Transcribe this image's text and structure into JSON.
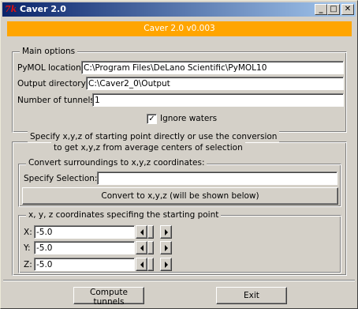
{
  "window": {
    "title": "Caver 2.0",
    "icon_text": "7k",
    "controls": {
      "minimize": "_",
      "maximize": "□",
      "close": "✕"
    }
  },
  "banner": {
    "text": "Caver 2.0 v0.003",
    "color": "#ffa500"
  },
  "main_options": {
    "label": "Main options",
    "pymol_label": "PyMOL location:",
    "pymol_value": "C:\\Program Files\\DeLano Scientific\\PyMOL10",
    "output_label": "Output directory:",
    "output_value": "C:\\Caver2_0\\Output",
    "tunnels_label": "Number of tunnels:",
    "tunnels_value": "1",
    "ignore_waters_label": "Ignore waters",
    "ignore_waters_checked": true
  },
  "start_point": {
    "label_line1": "Specify x,y,z of starting point directly or use the conversion",
    "label_line2": "to get x,y,z from average centers of selection",
    "convert": {
      "label": "Convert surroundings to x,y,z coordinates:",
      "selection_label": "Specify Selection:",
      "selection_value": "",
      "button_label": "Convert to x,y,z (will be shown below)"
    },
    "coords": {
      "label": "x, y, z coordinates specifing the starting point",
      "x_label": "X:",
      "x_value": "-5.0",
      "y_label": "Y:",
      "y_value": "-5.0",
      "z_label": "Z:",
      "z_value": "-5.0"
    }
  },
  "footer": {
    "compute_label": "Compute tunnels",
    "exit_label": "Exit"
  }
}
